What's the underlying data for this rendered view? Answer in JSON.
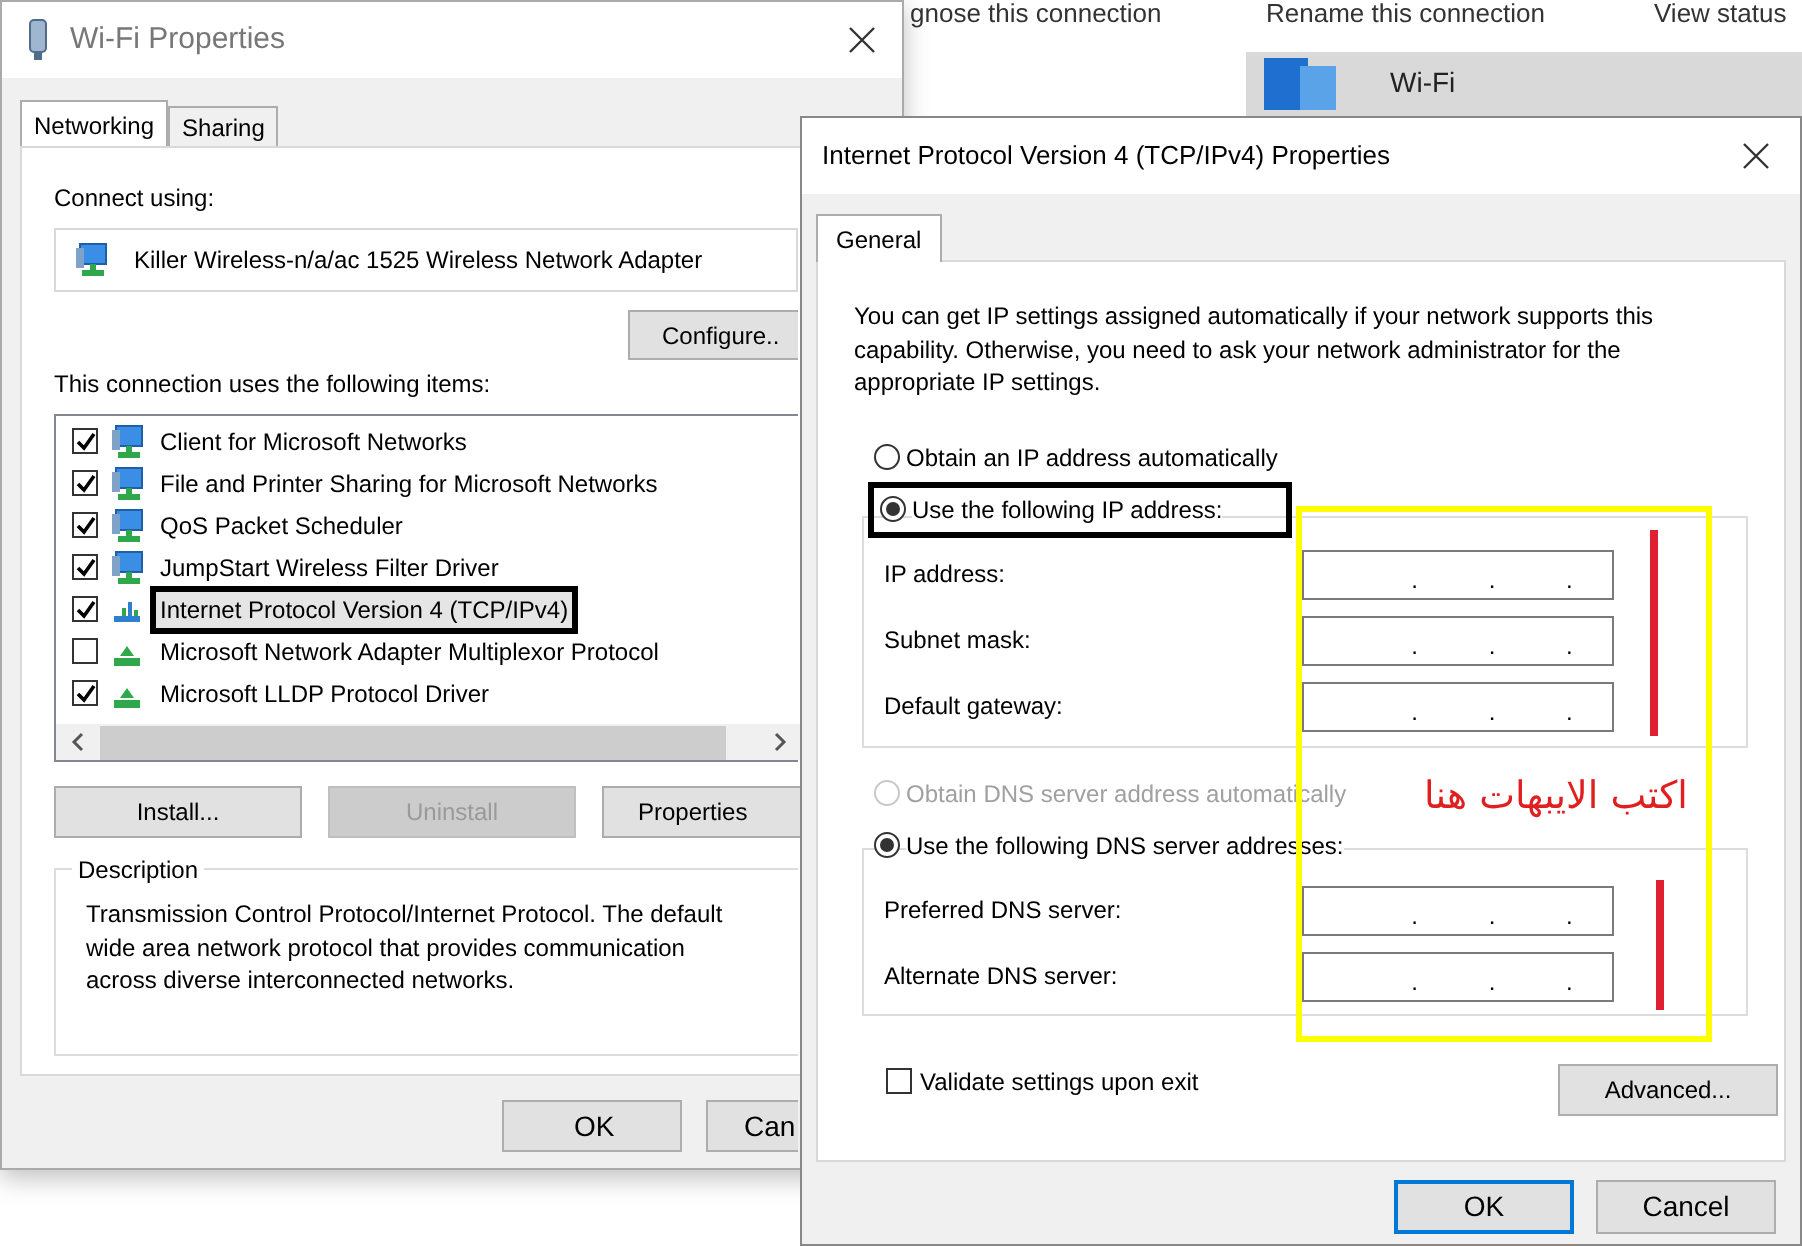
{
  "background_window": {
    "toolbar": [
      "gnose this connection",
      "Rename this connection",
      "View status"
    ],
    "connection": {
      "name": "Wi-Fi",
      "selected": true
    }
  },
  "wifi_properties": {
    "title": "Wi-Fi Properties",
    "tabs": [
      {
        "label": "Networking",
        "selected": true
      },
      {
        "label": "Sharing",
        "selected": false
      }
    ],
    "connect_using_label": "Connect using:",
    "adapter": "Killer Wireless-n/a/ac 1525 Wireless Network Adapter",
    "configure_button": "Configure..",
    "items_label": "This connection uses the following items:",
    "items": [
      {
        "label": "Client for Microsoft Networks",
        "checked": true,
        "selected": false,
        "kind": "service"
      },
      {
        "label": "File and Printer Sharing for Microsoft Networks",
        "checked": true,
        "selected": false,
        "kind": "service"
      },
      {
        "label": "QoS Packet Scheduler",
        "checked": true,
        "selected": false,
        "kind": "service"
      },
      {
        "label": "JumpStart Wireless Filter Driver",
        "checked": true,
        "selected": false,
        "kind": "service"
      },
      {
        "label": "Internet Protocol Version 4 (TCP/IPv4)",
        "checked": true,
        "selected": true,
        "kind": "tcpip",
        "highlighted": true
      },
      {
        "label": "Microsoft Network Adapter Multiplexor Protocol",
        "checked": false,
        "selected": false,
        "kind": "protocol"
      },
      {
        "label": "Microsoft LLDP Protocol Driver",
        "checked": true,
        "selected": false,
        "kind": "protocol"
      }
    ],
    "buttons": [
      {
        "label": "Install...",
        "disabled": false
      },
      {
        "label": "Uninstall",
        "disabled": true
      },
      {
        "label": "Properties",
        "disabled": false
      }
    ],
    "description": {
      "title": "Description",
      "text": "Transmission Control Protocol/Internet Protocol. The default wide area network protocol that provides communication across diverse interconnected networks."
    },
    "footer_buttons": [
      "OK",
      "Can"
    ]
  },
  "ipv4_dialog": {
    "title": "Internet Protocol Version 4 (TCP/IPv4) Properties",
    "tabs": [
      {
        "label": "General",
        "selected": true
      }
    ],
    "intro": "You can get IP settings assigned automatically if your network supports this capability. Otherwise, you need to ask your network administrator for the appropriate IP settings.",
    "ip_options": [
      {
        "label": "Obtain an IP address automatically",
        "selected": false,
        "disabled": false,
        "highlighted": false
      },
      {
        "label": "Use the following IP address:",
        "selected": true,
        "disabled": false,
        "highlighted": true
      }
    ],
    "ip_fields": [
      {
        "label": "IP address:",
        "separators": [
          ".",
          ".",
          "."
        ]
      },
      {
        "label": "Subnet mask:",
        "separators": [
          ".",
          ".",
          "."
        ]
      },
      {
        "label": "Default gateway:",
        "separators": [
          ".",
          ".",
          "."
        ]
      }
    ],
    "dns_options": [
      {
        "label": "Obtain DNS server address automatically",
        "selected": false,
        "disabled": true
      },
      {
        "label": "Use the following DNS server addresses:",
        "selected": true,
        "disabled": false
      }
    ],
    "dns_fields": [
      {
        "label": "Preferred DNS server:",
        "separators": [
          ".",
          ".",
          "."
        ]
      },
      {
        "label": "Alternate DNS server:",
        "separators": [
          ".",
          ".",
          "."
        ]
      }
    ],
    "validate": {
      "label": "Validate settings upon exit",
      "checked": false
    },
    "advanced_button": "Advanced...",
    "footer_buttons": [
      {
        "label": "OK",
        "default": true
      },
      {
        "label": "Cancel",
        "default": false
      }
    ]
  },
  "annotation": {
    "text": "اكتب الايبهات هنا"
  }
}
